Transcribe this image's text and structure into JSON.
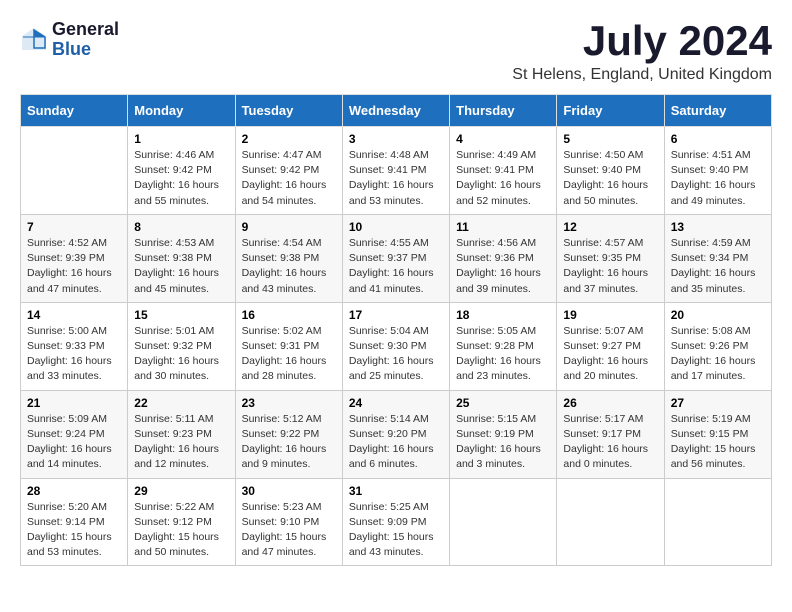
{
  "logo": {
    "general": "General",
    "blue": "Blue"
  },
  "title": {
    "month_year": "July 2024",
    "location": "St Helens, England, United Kingdom"
  },
  "days_of_week": [
    "Sunday",
    "Monday",
    "Tuesday",
    "Wednesday",
    "Thursday",
    "Friday",
    "Saturday"
  ],
  "weeks": [
    [
      {
        "day": "",
        "info": ""
      },
      {
        "day": "1",
        "info": "Sunrise: 4:46 AM\nSunset: 9:42 PM\nDaylight: 16 hours\nand 55 minutes."
      },
      {
        "day": "2",
        "info": "Sunrise: 4:47 AM\nSunset: 9:42 PM\nDaylight: 16 hours\nand 54 minutes."
      },
      {
        "day": "3",
        "info": "Sunrise: 4:48 AM\nSunset: 9:41 PM\nDaylight: 16 hours\nand 53 minutes."
      },
      {
        "day": "4",
        "info": "Sunrise: 4:49 AM\nSunset: 9:41 PM\nDaylight: 16 hours\nand 52 minutes."
      },
      {
        "day": "5",
        "info": "Sunrise: 4:50 AM\nSunset: 9:40 PM\nDaylight: 16 hours\nand 50 minutes."
      },
      {
        "day": "6",
        "info": "Sunrise: 4:51 AM\nSunset: 9:40 PM\nDaylight: 16 hours\nand 49 minutes."
      }
    ],
    [
      {
        "day": "7",
        "info": "Sunrise: 4:52 AM\nSunset: 9:39 PM\nDaylight: 16 hours\nand 47 minutes."
      },
      {
        "day": "8",
        "info": "Sunrise: 4:53 AM\nSunset: 9:38 PM\nDaylight: 16 hours\nand 45 minutes."
      },
      {
        "day": "9",
        "info": "Sunrise: 4:54 AM\nSunset: 9:38 PM\nDaylight: 16 hours\nand 43 minutes."
      },
      {
        "day": "10",
        "info": "Sunrise: 4:55 AM\nSunset: 9:37 PM\nDaylight: 16 hours\nand 41 minutes."
      },
      {
        "day": "11",
        "info": "Sunrise: 4:56 AM\nSunset: 9:36 PM\nDaylight: 16 hours\nand 39 minutes."
      },
      {
        "day": "12",
        "info": "Sunrise: 4:57 AM\nSunset: 9:35 PM\nDaylight: 16 hours\nand 37 minutes."
      },
      {
        "day": "13",
        "info": "Sunrise: 4:59 AM\nSunset: 9:34 PM\nDaylight: 16 hours\nand 35 minutes."
      }
    ],
    [
      {
        "day": "14",
        "info": "Sunrise: 5:00 AM\nSunset: 9:33 PM\nDaylight: 16 hours\nand 33 minutes."
      },
      {
        "day": "15",
        "info": "Sunrise: 5:01 AM\nSunset: 9:32 PM\nDaylight: 16 hours\nand 30 minutes."
      },
      {
        "day": "16",
        "info": "Sunrise: 5:02 AM\nSunset: 9:31 PM\nDaylight: 16 hours\nand 28 minutes."
      },
      {
        "day": "17",
        "info": "Sunrise: 5:04 AM\nSunset: 9:30 PM\nDaylight: 16 hours\nand 25 minutes."
      },
      {
        "day": "18",
        "info": "Sunrise: 5:05 AM\nSunset: 9:28 PM\nDaylight: 16 hours\nand 23 minutes."
      },
      {
        "day": "19",
        "info": "Sunrise: 5:07 AM\nSunset: 9:27 PM\nDaylight: 16 hours\nand 20 minutes."
      },
      {
        "day": "20",
        "info": "Sunrise: 5:08 AM\nSunset: 9:26 PM\nDaylight: 16 hours\nand 17 minutes."
      }
    ],
    [
      {
        "day": "21",
        "info": "Sunrise: 5:09 AM\nSunset: 9:24 PM\nDaylight: 16 hours\nand 14 minutes."
      },
      {
        "day": "22",
        "info": "Sunrise: 5:11 AM\nSunset: 9:23 PM\nDaylight: 16 hours\nand 12 minutes."
      },
      {
        "day": "23",
        "info": "Sunrise: 5:12 AM\nSunset: 9:22 PM\nDaylight: 16 hours\nand 9 minutes."
      },
      {
        "day": "24",
        "info": "Sunrise: 5:14 AM\nSunset: 9:20 PM\nDaylight: 16 hours\nand 6 minutes."
      },
      {
        "day": "25",
        "info": "Sunrise: 5:15 AM\nSunset: 9:19 PM\nDaylight: 16 hours\nand 3 minutes."
      },
      {
        "day": "26",
        "info": "Sunrise: 5:17 AM\nSunset: 9:17 PM\nDaylight: 16 hours\nand 0 minutes."
      },
      {
        "day": "27",
        "info": "Sunrise: 5:19 AM\nSunset: 9:15 PM\nDaylight: 15 hours\nand 56 minutes."
      }
    ],
    [
      {
        "day": "28",
        "info": "Sunrise: 5:20 AM\nSunset: 9:14 PM\nDaylight: 15 hours\nand 53 minutes."
      },
      {
        "day": "29",
        "info": "Sunrise: 5:22 AM\nSunset: 9:12 PM\nDaylight: 15 hours\nand 50 minutes."
      },
      {
        "day": "30",
        "info": "Sunrise: 5:23 AM\nSunset: 9:10 PM\nDaylight: 15 hours\nand 47 minutes."
      },
      {
        "day": "31",
        "info": "Sunrise: 5:25 AM\nSunset: 9:09 PM\nDaylight: 15 hours\nand 43 minutes."
      },
      {
        "day": "",
        "info": ""
      },
      {
        "day": "",
        "info": ""
      },
      {
        "day": "",
        "info": ""
      }
    ]
  ]
}
